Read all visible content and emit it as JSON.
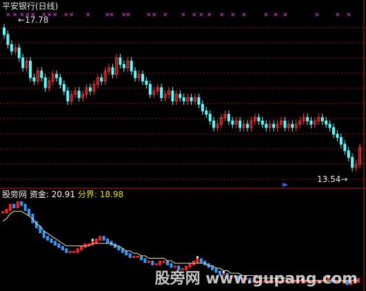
{
  "chart_data": {
    "type": "candlestick",
    "title": "平安银行(日线)",
    "price_panel": {
      "high_label": "17.78",
      "low_label": "13.54",
      "ylim": [
        13.2,
        18.1
      ],
      "up_color": "#ff3333",
      "down_color": "#54ffff",
      "closes": [
        17.6,
        17.3,
        17.1,
        17.2,
        16.9,
        16.6,
        16.8,
        16.3,
        16.2,
        16.5,
        16.3,
        16.0,
        16.2,
        16.4,
        16.3,
        16.1,
        15.9,
        15.6,
        15.8,
        15.9,
        15.7,
        15.8,
        16.0,
        15.9,
        16.1,
        16.3,
        16.2,
        16.5,
        16.6,
        16.4,
        16.9,
        16.7,
        16.6,
        16.8,
        16.5,
        16.3,
        16.4,
        16.2,
        16.1,
        15.8,
        15.9,
        16.0,
        15.7,
        15.8,
        15.9,
        15.6,
        15.8,
        15.7,
        15.6,
        15.7,
        15.6,
        15.7,
        15.5,
        15.3,
        15.2,
        15.0,
        14.8,
        14.9,
        15.1,
        15.2,
        15.0,
        14.9,
        15.0,
        14.8,
        14.9,
        14.8,
        15.0,
        15.1,
        15.0,
        14.9,
        14.8,
        14.9,
        14.8,
        14.9,
        15.0,
        14.8,
        14.9,
        14.8,
        14.9,
        15.0,
        15.1,
        15.0,
        14.9,
        15.0,
        15.1,
        15.0,
        14.9,
        14.8,
        14.6,
        14.5,
        14.3,
        14.1,
        13.9,
        13.6,
        13.7,
        14.2
      ],
      "cross_markers": "magenta x markers along top",
      "cross_color": "#ff44ff"
    },
    "indicator_panel": {
      "name": "股旁网",
      "fund_label": "资金:",
      "fund_value": "20.91",
      "divide_label": "分界:",
      "divide_value": "18.98",
      "line_color": "#e6e6a0",
      "bar_up_color": "#ff2222",
      "bar_down_color": "#3399ff",
      "fund_series": [
        96,
        97,
        99,
        98,
        100,
        99,
        97,
        95,
        92,
        90,
        88,
        86,
        85,
        84,
        83,
        82,
        81,
        80,
        80,
        80,
        81,
        82,
        83,
        83,
        84,
        85,
        86,
        85,
        84,
        83,
        82,
        81,
        80,
        79,
        78,
        78,
        78,
        77,
        76,
        76,
        75,
        75,
        76,
        76,
        75,
        74,
        74,
        73,
        73,
        74,
        75,
        76,
        77,
        76,
        75,
        74,
        73,
        72,
        71,
        71,
        70,
        70,
        70,
        69,
        69,
        69,
        68,
        68,
        68,
        68,
        68,
        68,
        68,
        68,
        68,
        68,
        68,
        68,
        68,
        68,
        68,
        68,
        68,
        68,
        68,
        68,
        69,
        69,
        68,
        68,
        68,
        68,
        67,
        68,
        68,
        69
      ],
      "divide_series": [
        92,
        93,
        95,
        96,
        96,
        96,
        95,
        94,
        93,
        91,
        90,
        88,
        87,
        86,
        85,
        84,
        83,
        82,
        82,
        82,
        82,
        82,
        82,
        82,
        83,
        83,
        83,
        83,
        83,
        83,
        82,
        82,
        81,
        80,
        80,
        79,
        79,
        78,
        78,
        77,
        77,
        77,
        77,
        77,
        76,
        76,
        75,
        75,
        75,
        75,
        75,
        75,
        75,
        75,
        75,
        74,
        74,
        73,
        73,
        72,
        72,
        71,
        71,
        71,
        70,
        70,
        70,
        70,
        69,
        69,
        69,
        69,
        69,
        69,
        69,
        69,
        69,
        68,
        68,
        68,
        68,
        68,
        68,
        68,
        68,
        68,
        68,
        68,
        68,
        68,
        68,
        68,
        68,
        68,
        68,
        68
      ]
    }
  },
  "watermark": "股旁网 www.gupang.com"
}
